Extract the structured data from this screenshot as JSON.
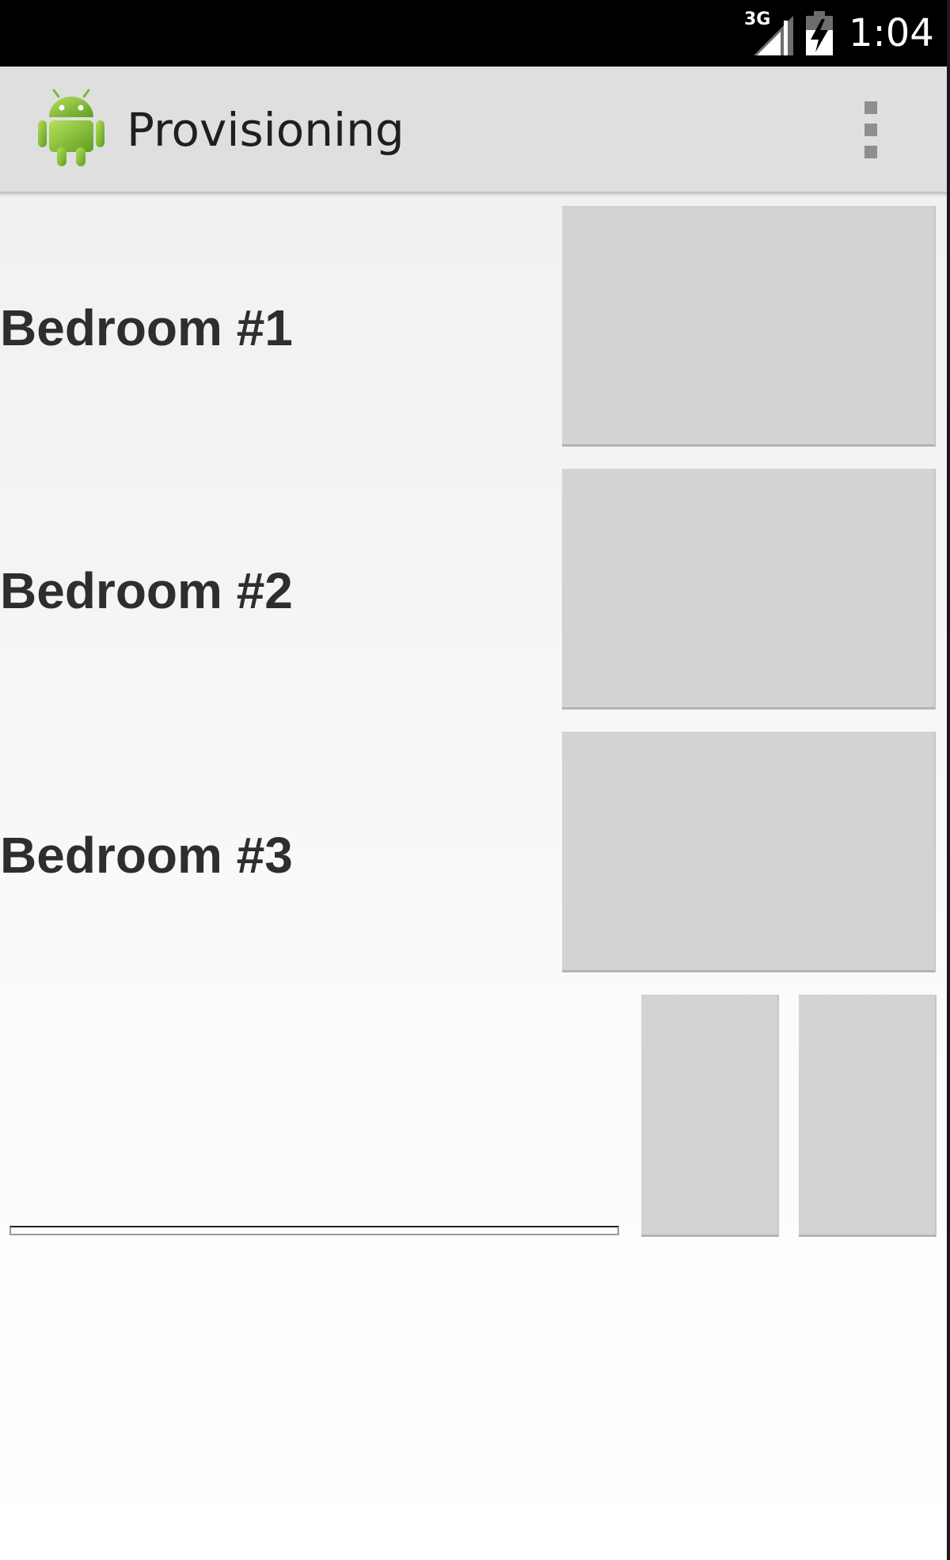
{
  "status_bar": {
    "network": "3G",
    "time": "1:04",
    "icons": [
      "signal-icon",
      "battery-charging-icon"
    ]
  },
  "action_bar": {
    "app_icon": "android-robot-icon",
    "title": "Provisioning",
    "overflow_icon": "overflow-menu-icon"
  },
  "rooms": [
    {
      "label": "Bedroom #1"
    },
    {
      "label": "Bedroom #2"
    },
    {
      "label": "Bedroom #3"
    }
  ],
  "text_input": {
    "value": "",
    "placeholder": ""
  },
  "colors": {
    "status_bar_bg": "#000000",
    "action_bar_bg": "#dfdfdf",
    "tile_bg": "#d3d3d3",
    "android_green": "#8cc63e",
    "label_text": "#2e2e2e"
  }
}
